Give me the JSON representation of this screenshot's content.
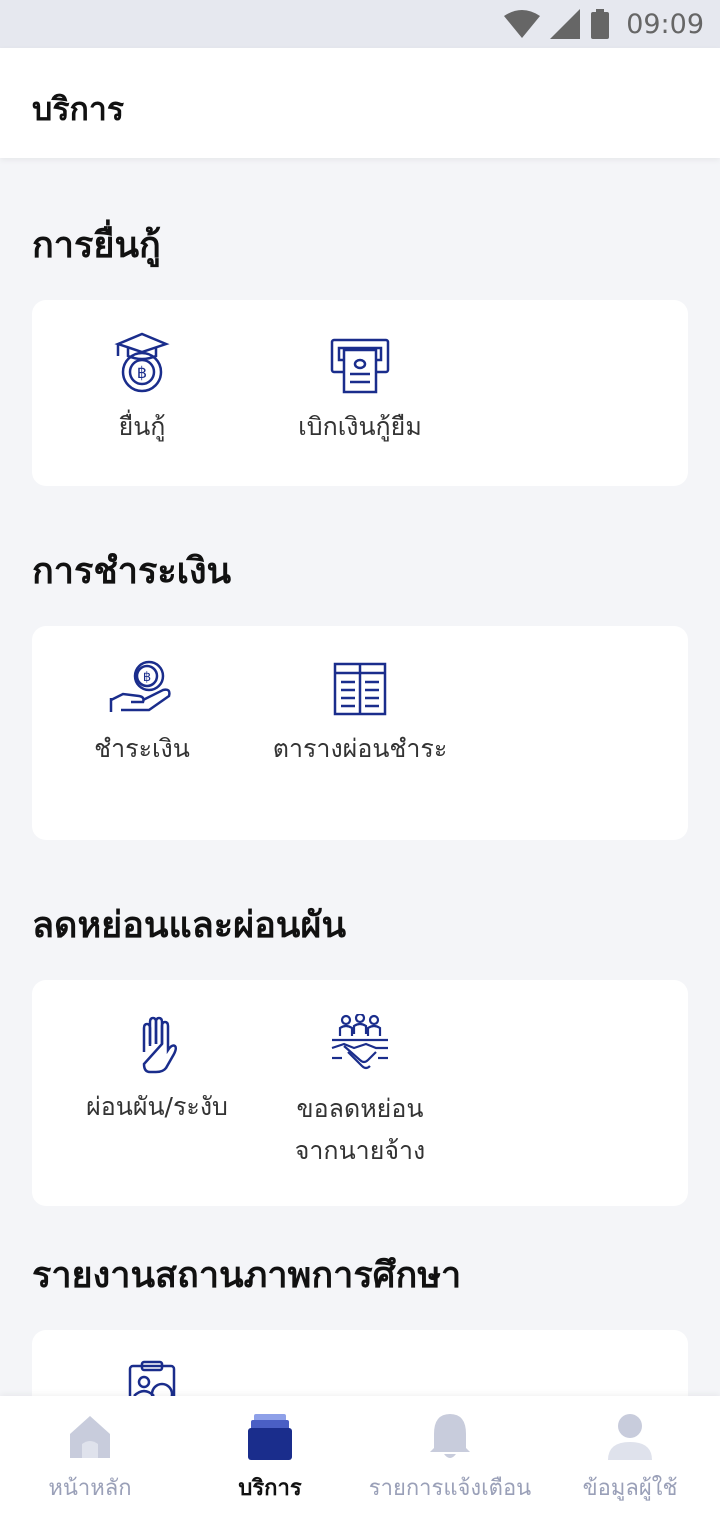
{
  "status_bar": {
    "time": "09:09"
  },
  "header": {
    "title": "บริการ"
  },
  "sections": [
    {
      "title": "การยื่นกู้",
      "items": [
        {
          "label": "ยื่นกู้"
        },
        {
          "label": "เบิกเงินกู้ยืม"
        }
      ]
    },
    {
      "title": "การชำระเงิน",
      "items": [
        {
          "label": "ชำระเงิน"
        },
        {
          "label": "ตารางผ่อนชำระ"
        }
      ]
    },
    {
      "title": "ลดหย่อนและผ่อนผัน",
      "items": [
        {
          "label": "ผ่อนผัน/ระงับ"
        },
        {
          "label_line1": "ขอลดหย่อน",
          "label_line2": "จากนายจ้าง"
        }
      ]
    },
    {
      "title": "รายงานสถานภาพการศึกษา"
    }
  ],
  "bottom_nav": [
    {
      "label": "หน้าหลัก",
      "icon": "home-icon"
    },
    {
      "label": "บริการ",
      "icon": "services-icon",
      "active": true
    },
    {
      "label": "รายการแจ้งเตือน",
      "icon": "bell-icon"
    },
    {
      "label": "ข้อมูลผู้ใช้",
      "icon": "user-icon"
    }
  ],
  "colors": {
    "accent": "#1a2d8c",
    "inactive": "#c8ccdc",
    "background": "#f4f5f8"
  }
}
